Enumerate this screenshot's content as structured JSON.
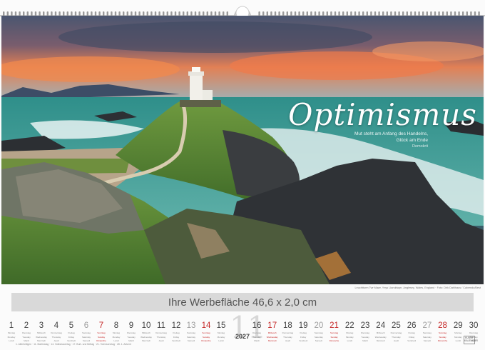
{
  "title": "Optimismus",
  "quote": {
    "lines": [
      "Mut steht am Anfang des Handelns,",
      "Glück am Ende"
    ],
    "author": "Demokrit"
  },
  "credit": "Leuchtturm Twr Mawr, Ynys Llanddwyn, Anglesey, Wales, England · Foto: Dirk Dahlhaus / Calvendo/Best",
  "ad_text": "Ihre Werbefläche 46,6 x 2,0 cm",
  "month_number": "11",
  "year": "2027",
  "legend_text": "1. Allerheiligen · 11. Martinstag · 14. Volkstrauertag · 17. Buß- und Bettag · 21. Totensonntag · 28. 1. Advent",
  "brand": "KUNST KALENDER",
  "colors": {
    "sea": "#2f8f8a",
    "sky_glow": "#f07a4a",
    "grass": "#5b8a35",
    "sunday": "#c62828",
    "ad_bar": "#d9d9d9"
  },
  "days": [
    {
      "n": "1",
      "lbl": [
        "Montag",
        "Monday",
        "Lundi"
      ],
      "type": "weekday"
    },
    {
      "n": "2",
      "lbl": [
        "Dienstag",
        "Tuesday",
        "Mardi"
      ],
      "type": "weekday"
    },
    {
      "n": "3",
      "lbl": [
        "Mittwoch",
        "Wednesday",
        "Mercredi"
      ],
      "type": "weekday"
    },
    {
      "n": "4",
      "lbl": [
        "Donnerstag",
        "Thursday",
        "Jeudi"
      ],
      "type": "weekday"
    },
    {
      "n": "5",
      "lbl": [
        "Freitag",
        "Friday",
        "Vendredi"
      ],
      "type": "weekday"
    },
    {
      "n": "6",
      "lbl": [
        "Samstag",
        "Saturday",
        "Samedi"
      ],
      "type": "saturday"
    },
    {
      "n": "7",
      "lbl": [
        "Sonntag",
        "Sunday",
        "Dimanche"
      ],
      "type": "sunday"
    },
    {
      "n": "8",
      "lbl": [
        "Montag",
        "Monday",
        "Lundi"
      ],
      "type": "weekday"
    },
    {
      "n": "9",
      "lbl": [
        "Dienstag",
        "Tuesday",
        "Mardi"
      ],
      "type": "weekday"
    },
    {
      "n": "10",
      "lbl": [
        "Mittwoch",
        "Wednesday",
        "Mercredi"
      ],
      "type": "weekday"
    },
    {
      "n": "11",
      "lbl": [
        "Donnerstag",
        "Thursday",
        "Jeudi"
      ],
      "type": "weekday"
    },
    {
      "n": "12",
      "lbl": [
        "Freitag",
        "Friday",
        "Vendredi"
      ],
      "type": "weekday"
    },
    {
      "n": "13",
      "lbl": [
        "Samstag",
        "Saturday",
        "Samedi"
      ],
      "type": "saturday"
    },
    {
      "n": "14",
      "lbl": [
        "Sonntag",
        "Sunday",
        "Dimanche"
      ],
      "type": "sunday"
    },
    {
      "n": "15",
      "lbl": [
        "Montag",
        "Monday",
        "Lundi"
      ],
      "type": "weekday"
    },
    {
      "n": "16",
      "lbl": [
        "Dienstag",
        "Tuesday",
        "Mardi"
      ],
      "type": "weekday"
    },
    {
      "n": "17",
      "lbl": [
        "Mittwoch",
        "Wednesday",
        "Mercredi"
      ],
      "type": "sunday"
    },
    {
      "n": "18",
      "lbl": [
        "Donnerstag",
        "Thursday",
        "Jeudi"
      ],
      "type": "weekday"
    },
    {
      "n": "19",
      "lbl": [
        "Freitag",
        "Friday",
        "Vendredi"
      ],
      "type": "weekday"
    },
    {
      "n": "20",
      "lbl": [
        "Samstag",
        "Saturday",
        "Samedi"
      ],
      "type": "saturday"
    },
    {
      "n": "21",
      "lbl": [
        "Sonntag",
        "Sunday",
        "Dimanche"
      ],
      "type": "sunday"
    },
    {
      "n": "22",
      "lbl": [
        "Montag",
        "Monday",
        "Lundi"
      ],
      "type": "weekday"
    },
    {
      "n": "23",
      "lbl": [
        "Dienstag",
        "Tuesday",
        "Mardi"
      ],
      "type": "weekday"
    },
    {
      "n": "24",
      "lbl": [
        "Mittwoch",
        "Wednesday",
        "Mercredi"
      ],
      "type": "weekday"
    },
    {
      "n": "25",
      "lbl": [
        "Donnerstag",
        "Thursday",
        "Jeudi"
      ],
      "type": "weekday"
    },
    {
      "n": "26",
      "lbl": [
        "Freitag",
        "Friday",
        "Vendredi"
      ],
      "type": "weekday"
    },
    {
      "n": "27",
      "lbl": [
        "Samstag",
        "Saturday",
        "Samedi"
      ],
      "type": "saturday"
    },
    {
      "n": "28",
      "lbl": [
        "Sonntag",
        "Sunday",
        "Dimanche"
      ],
      "type": "sunday"
    },
    {
      "n": "29",
      "lbl": [
        "Montag",
        "Monday",
        "Lundi"
      ],
      "type": "weekday"
    },
    {
      "n": "30",
      "lbl": [
        "Dienstag",
        "Tuesday",
        "Mardi"
      ],
      "type": "weekday"
    }
  ]
}
